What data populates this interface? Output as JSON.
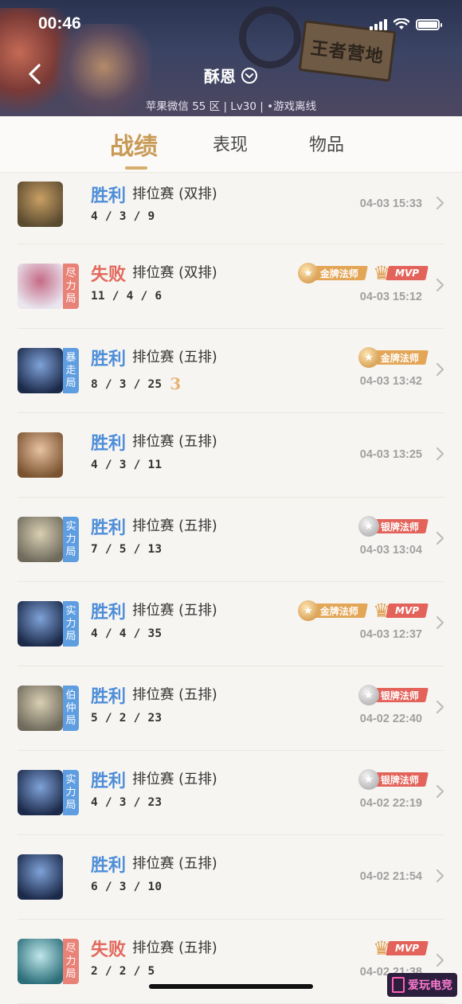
{
  "status_bar": {
    "time": "00:46"
  },
  "header": {
    "sign_text": "王者营地",
    "player_name": "酥恩",
    "player_info": "苹果微信 55 区 | Lv30 | •游戏离线"
  },
  "tabs": [
    {
      "label": "战绩",
      "active": true
    },
    {
      "label": "表现",
      "active": false
    },
    {
      "label": "物品",
      "active": false
    }
  ],
  "matches": [
    {
      "result": "胜利",
      "outcome": "win",
      "mode": "排位赛 (双排)",
      "kda": "4 / 3 / 9",
      "time": "04-03 15:33",
      "tag": "",
      "streak": "",
      "badges": [],
      "avatar_colors": [
        "#5a4a30",
        "#c9a064"
      ]
    },
    {
      "result": "失败",
      "outcome": "lose",
      "mode": "排位赛 (双排)",
      "kda": "11 / 4 / 6",
      "time": "04-03 15:12",
      "tag": "尽力局",
      "tag_color": "red",
      "streak": "",
      "badges": [
        "金牌法师",
        "MVP"
      ],
      "avatar_colors": [
        "#e9e6f0",
        "#c66b86"
      ]
    },
    {
      "result": "胜利",
      "outcome": "win",
      "mode": "排位赛 (五排)",
      "kda": "8 / 3 / 25",
      "time": "04-03 13:42",
      "tag": "暴走局",
      "tag_color": "blue",
      "streak": "3",
      "badges": [
        "金牌法师"
      ],
      "avatar_colors": [
        "#1c2a4a",
        "#7fa2d8"
      ]
    },
    {
      "result": "胜利",
      "outcome": "win",
      "mode": "排位赛 (五排)",
      "kda": "4 / 3 / 11",
      "time": "04-03 13:25",
      "tag": "",
      "streak": "",
      "badges": [],
      "avatar_colors": [
        "#7a5330",
        "#e8c3a2"
      ]
    },
    {
      "result": "胜利",
      "outcome": "win",
      "mode": "排位赛 (五排)",
      "kda": "7 / 5 / 13",
      "time": "04-03 13:04",
      "tag": "实力局",
      "tag_color": "blue",
      "streak": "",
      "badges": [
        "银牌法师"
      ],
      "avatar_colors": [
        "#6f6a5c",
        "#d9cfb3"
      ]
    },
    {
      "result": "胜利",
      "outcome": "win",
      "mode": "排位赛 (五排)",
      "kda": "4 / 4 / 35",
      "time": "04-03 12:37",
      "tag": "实力局",
      "tag_color": "blue",
      "streak": "",
      "badges": [
        "金牌法师",
        "MVP"
      ],
      "avatar_colors": [
        "#1c2a4a",
        "#7fa2d8"
      ]
    },
    {
      "result": "胜利",
      "outcome": "win",
      "mode": "排位赛 (五排)",
      "kda": "5 / 2 / 23",
      "time": "04-02 22:40",
      "tag": "伯仲局",
      "tag_color": "blue",
      "streak": "",
      "badges": [
        "银牌法师"
      ],
      "avatar_colors": [
        "#6f6a5c",
        "#d9cfb3"
      ]
    },
    {
      "result": "胜利",
      "outcome": "win",
      "mode": "排位赛 (五排)",
      "kda": "4 / 3 / 23",
      "time": "04-02 22:19",
      "tag": "实力局",
      "tag_color": "blue",
      "streak": "",
      "badges": [
        "银牌法师"
      ],
      "avatar_colors": [
        "#1c2a4a",
        "#7fa2d8"
      ]
    },
    {
      "result": "胜利",
      "outcome": "win",
      "mode": "排位赛 (五排)",
      "kda": "6 / 3 / 10",
      "time": "04-02 21:54",
      "tag": "",
      "streak": "",
      "badges": [],
      "avatar_colors": [
        "#1c2a4a",
        "#7fa2d8"
      ]
    },
    {
      "result": "失败",
      "outcome": "lose",
      "mode": "排位赛 (五排)",
      "kda": "2 / 2 / 5",
      "time": "04-02 21:38",
      "tag": "尽力局",
      "tag_color": "red",
      "streak": "",
      "badges": [
        "MVP"
      ],
      "avatar_colors": [
        "#2c6f7a",
        "#bfe6ea"
      ]
    }
  ],
  "watermark": "爱玩电竞",
  "colors": {
    "win": "#4e8ed8",
    "lose": "#e2695c",
    "accent": "#c89a56"
  }
}
